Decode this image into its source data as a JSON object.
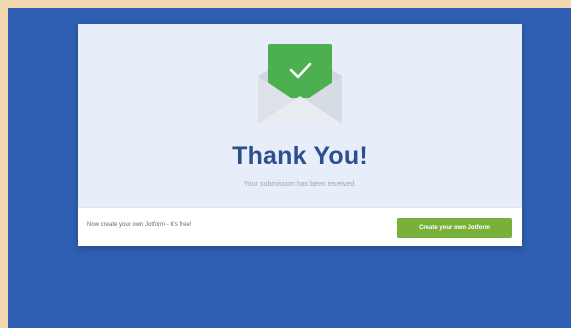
{
  "page": {
    "title": "Thank You!",
    "subtitle": "Your submission has been received.",
    "footer_text": "Now create your own Jotform - It's free!",
    "cta_label": "Create your own Jotform"
  },
  "icons": {
    "hero": "envelope-check-icon"
  },
  "colors": {
    "outer_background": "#f3d9b0",
    "page_background": "#2f5fb3",
    "card_background": "#e8eef9",
    "title": "#2d4f8e",
    "check_card": "#4caf50",
    "cta_button": "#78b13a"
  }
}
